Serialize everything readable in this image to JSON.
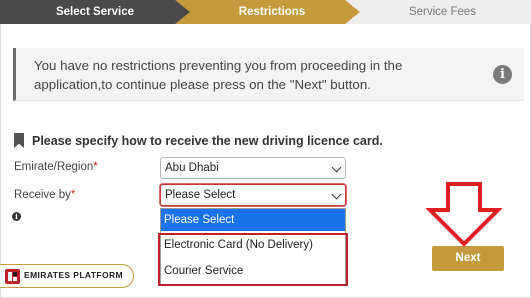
{
  "wizard": {
    "steps": [
      {
        "label": "Select Service",
        "state": "completed"
      },
      {
        "label": "Restrictions",
        "state": "active"
      },
      {
        "label": "Service Fees",
        "state": "pending"
      }
    ]
  },
  "info_box": {
    "message": "You have no restrictions preventing you from proceeding in the application,to continue please press on the \"Next\" button.",
    "icon": "info-icon"
  },
  "section": {
    "title": "Please specify how to receive the new driving licence card.",
    "icon": "bookmark-icon"
  },
  "form": {
    "emirate": {
      "label": "Emirate/Region",
      "required_mark": "*",
      "value": "Abu Dhabi"
    },
    "receive_by": {
      "label": "Receive by",
      "required_mark": "*",
      "value": "Please Select"
    }
  },
  "dropdown": {
    "options": [
      "Please Select",
      "Electronic Card (No Delivery)",
      "Courier Service"
    ],
    "selected_index": 0
  },
  "actions": {
    "next_label": "Next"
  },
  "branding": {
    "logo_text": "EMIRATES PLATFORM",
    "logo_mark": "EP"
  },
  "colors": {
    "accent": "#c49a3c",
    "dark_step": "#4a4a4a",
    "highlight_red": "#c0202a",
    "selection_blue": "#1a73e8"
  }
}
